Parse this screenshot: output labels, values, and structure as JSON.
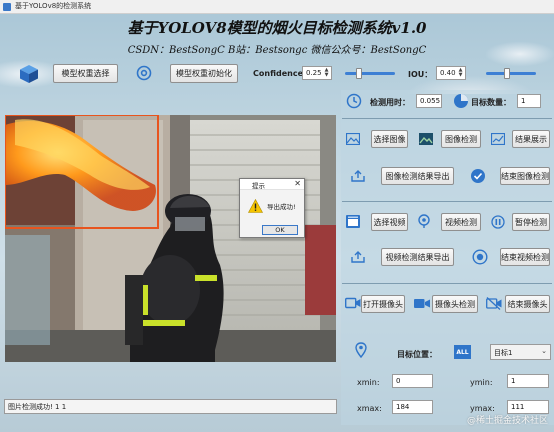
{
  "window": {
    "title": "基于YOLOv8的检测系统"
  },
  "header": {
    "title": "基于YOLOV8模型的烟火目标检测系统v1.0",
    "subtitle": "CSDN：BestSongC   B站：Bestsongc   微信公众号：BestSongC"
  },
  "toolbar": {
    "model_select_label": "模型权重选择",
    "model_init_label": "模型权重初始化",
    "confidence_label": "Confidence:",
    "confidence_value": "0.25",
    "confidence_level": 0.25,
    "iou_label": "IOU：",
    "iou_value": "0.40",
    "iou_level": 0.4
  },
  "stats": {
    "time_label": "检测用时：",
    "time_value": "0.055",
    "count_label": "目标数量：",
    "count_value": "1"
  },
  "image_section": {
    "select_label": "选择图像",
    "detect_label": "图像检测",
    "show_result_label": "结果展示",
    "export_label": "图像检测结果导出",
    "end_label": "结束图像检测"
  },
  "video_section": {
    "select_label": "选择视频",
    "detect_label": "视频检测",
    "pause_label": "暂停检测",
    "export_label": "视频检测结果导出",
    "end_label": "结束视频检测"
  },
  "camera_section": {
    "open_label": "打开摄像头",
    "detect_label": "摄像头检测",
    "end_label": "结束摄像头"
  },
  "target": {
    "position_label": "目标位置：",
    "all_badge": "ALL",
    "selected": "目标1",
    "xmin_label": "xmin:",
    "xmin_value": "0",
    "ymin_label": "ymin:",
    "ymin_value": "1",
    "xmax_label": "xmax:",
    "xmax_value": "184",
    "ymax_label": "ymax:",
    "ymax_value": "111"
  },
  "status_bar": {
    "text": "图片检测成功! 1 1"
  },
  "dialog": {
    "title": "提示",
    "message": "导出成功!",
    "ok_label": "OK"
  },
  "watermark": "@稀土掘金技术社区",
  "colors": {
    "accent": "#3d7fd4",
    "detection_box": "#e8541e"
  }
}
